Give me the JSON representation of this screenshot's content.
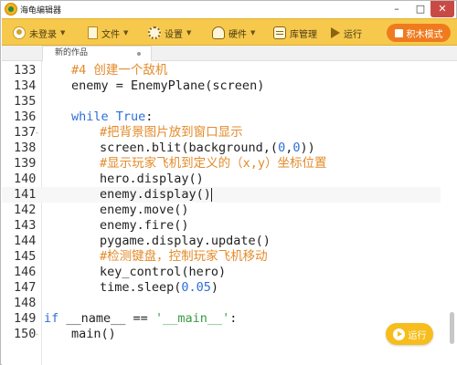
{
  "window": {
    "title": "海龟编辑器",
    "controls": {
      "minimize": "–",
      "maximize": "□",
      "close": "✕"
    }
  },
  "toolbar": {
    "items": [
      {
        "label": "未登录",
        "icon": "avatar-icon",
        "has_dropdown": true
      },
      {
        "label": "文件",
        "icon": "file-icon",
        "has_dropdown": true
      },
      {
        "label": "设置",
        "icon": "gear-icon",
        "has_dropdown": true
      },
      {
        "label": "硬件",
        "icon": "hardware-icon",
        "has_dropdown": true
      },
      {
        "label": "库管理",
        "icon": "library-icon",
        "has_dropdown": false
      },
      {
        "label": "运行",
        "icon": "run-icon",
        "has_dropdown": false
      }
    ],
    "block_mode_label": "积木模式",
    "caret": "▼"
  },
  "tabs": [
    {
      "label": "新的作品",
      "unsaved": true
    }
  ],
  "editor": {
    "lines": [
      {
        "n": "133",
        "fold": "",
        "tokens": [
          {
            "t": "#4 创建一个敌机",
            "c": "comment"
          }
        ],
        "indent": 1
      },
      {
        "n": "134",
        "fold": "",
        "tokens": [
          {
            "t": "enemy = EnemyPlane(screen)",
            "c": "default"
          }
        ],
        "indent": 1
      },
      {
        "n": "135",
        "fold": "",
        "tokens": [],
        "indent": 0
      },
      {
        "n": "136",
        "fold": "",
        "tokens": [
          {
            "t": "while ",
            "c": "kw"
          },
          {
            "t": "True",
            "c": "kw"
          },
          {
            "t": ":",
            "c": "default"
          }
        ],
        "indent": 1
      },
      {
        "n": "137",
        "fold": "-",
        "tokens": [
          {
            "t": "#把背景图片放到窗口显示",
            "c": "comment"
          }
        ],
        "indent": 2
      },
      {
        "n": "138",
        "fold": "",
        "tokens": [
          {
            "t": "screen.blit(background,(",
            "c": "default"
          },
          {
            "t": "0",
            "c": "num"
          },
          {
            "t": ",",
            "c": "default"
          },
          {
            "t": "0",
            "c": "num"
          },
          {
            "t": "))",
            "c": "default"
          }
        ],
        "indent": 2
      },
      {
        "n": "139",
        "fold": "",
        "tokens": [
          {
            "t": "#显示玩家飞机到定义的（x,y）坐标位置",
            "c": "comment"
          }
        ],
        "indent": 2
      },
      {
        "n": "140",
        "fold": "",
        "tokens": [
          {
            "t": "hero.display()",
            "c": "default"
          }
        ],
        "indent": 2
      },
      {
        "n": "141",
        "fold": "",
        "tokens": [
          {
            "t": "enemy.display()",
            "c": "default"
          }
        ],
        "indent": 2,
        "active": true
      },
      {
        "n": "142",
        "fold": "",
        "tokens": [
          {
            "t": "enemy.move()",
            "c": "default"
          }
        ],
        "indent": 2
      },
      {
        "n": "143",
        "fold": "",
        "tokens": [
          {
            "t": "enemy.fire()",
            "c": "default"
          }
        ],
        "indent": 2
      },
      {
        "n": "144",
        "fold": "",
        "tokens": [
          {
            "t": "pygame.display.update()",
            "c": "default"
          }
        ],
        "indent": 2
      },
      {
        "n": "145",
        "fold": "",
        "tokens": [
          {
            "t": "#检测键盘，控制玩家飞机移动",
            "c": "comment"
          }
        ],
        "indent": 2
      },
      {
        "n": "146",
        "fold": "",
        "tokens": [
          {
            "t": "key_control(hero)",
            "c": "default"
          }
        ],
        "indent": 2
      },
      {
        "n": "147",
        "fold": "",
        "tokens": [
          {
            "t": "time.sleep(",
            "c": "default"
          },
          {
            "t": "0.05",
            "c": "num"
          },
          {
            "t": ")",
            "c": "default"
          }
        ],
        "indent": 2
      },
      {
        "n": "148",
        "fold": "",
        "tokens": [],
        "indent": 0
      },
      {
        "n": "149",
        "fold": "",
        "tokens": [
          {
            "t": "if ",
            "c": "kw"
          },
          {
            "t": "__name__ == ",
            "c": "default"
          },
          {
            "t": "'__main__'",
            "c": "str"
          },
          {
            "t": ":",
            "c": "default"
          }
        ],
        "indent": 0
      },
      {
        "n": "150",
        "fold": "-",
        "tokens": [
          {
            "t": "main()",
            "c": "default"
          }
        ],
        "indent": 1
      }
    ]
  },
  "run_button": {
    "label": "运行"
  },
  "colors": {
    "toolbar_bg": "#f6c94d",
    "accent_orange": "#f07b1f",
    "comment": "#e38b2a",
    "keyword": "#2e6fd6",
    "string": "#3a9a45"
  }
}
